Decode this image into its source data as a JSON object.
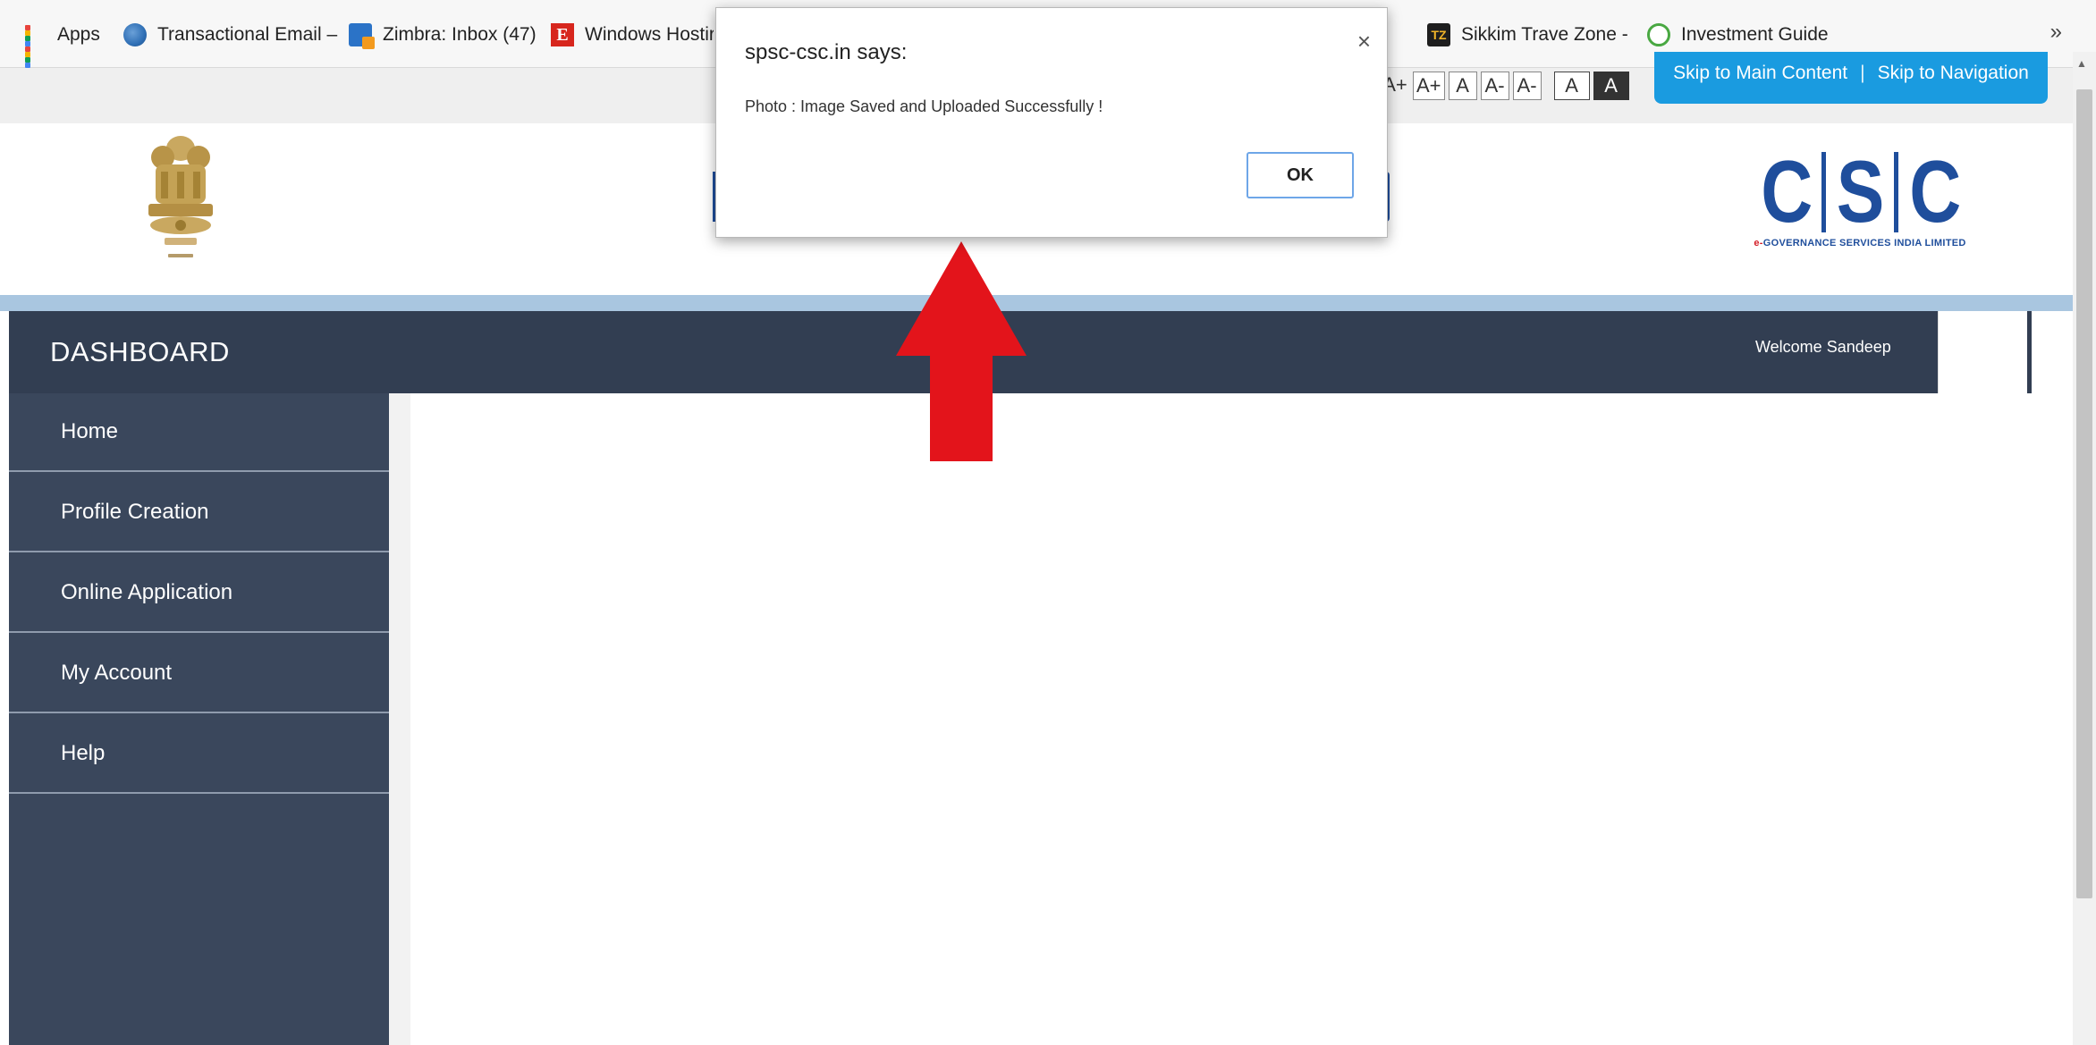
{
  "bookmarks": {
    "items": [
      {
        "label": "Apps",
        "icon": "apps-grid-icon"
      },
      {
        "label": "Transactional Email –",
        "icon": "globe-icon"
      },
      {
        "label": "Zimbra: Inbox (47)",
        "icon": "zimbra-icon"
      },
      {
        "label": "Windows Hostir",
        "icon": "e-logo-icon"
      },
      {
        "label": "Sikkim Trave Zone -",
        "icon": "tz-icon"
      },
      {
        "label": "Investment Guide",
        "icon": "investment-icon"
      }
    ],
    "overflow": "»"
  },
  "accessibility": {
    "font_sizes": [
      "A+",
      "A+",
      "A",
      "A-",
      "A-",
      "A",
      "A"
    ],
    "skip_main": "Skip to Main Content",
    "separator": "|",
    "skip_nav": "Skip to Navigation"
  },
  "header": {
    "csc_letters": [
      "C",
      "S",
      "C"
    ],
    "csc_tagline_prefix": "e-",
    "csc_tagline": "GOVERNANCE SERVICES INDIA LIMITED"
  },
  "dashboard": {
    "title": "DASHBOARD",
    "welcome": "Welcome Sandeep"
  },
  "sidebar": {
    "items": [
      {
        "label": "Home"
      },
      {
        "label": "Profile Creation"
      },
      {
        "label": "Online Application"
      },
      {
        "label": "My Account"
      },
      {
        "label": "Help"
      }
    ]
  },
  "dialog": {
    "title": "spsc-csc.in says:",
    "close": "×",
    "message": "Photo : Image Saved and Uploaded Successfully !",
    "ok_label": "OK"
  },
  "colors": {
    "dashbar": "#323e52",
    "sidebar": "#3a475c",
    "skip_bar": "#1a9be0",
    "csc_blue": "#1f4e9c",
    "arrow_red": "#e3141b"
  }
}
